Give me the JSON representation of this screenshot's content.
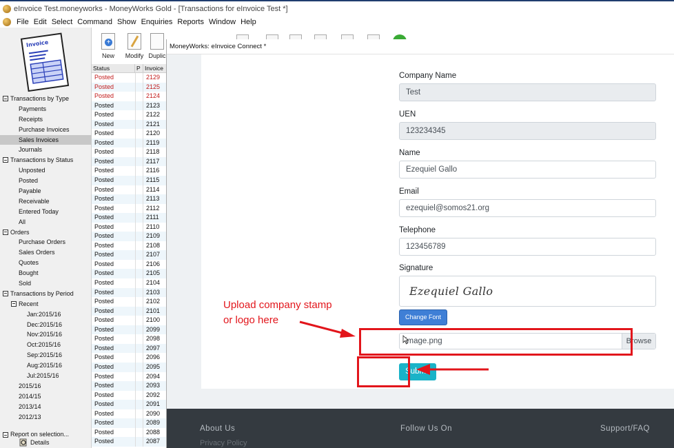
{
  "window": {
    "title": "eInvoice Test.moneyworks - MoneyWorks Gold - [Transactions for eInvoice Test *]"
  },
  "menubar": {
    "items": [
      "File",
      "Edit",
      "Select",
      "Command",
      "Show",
      "Enquiries",
      "Reports",
      "Window",
      "Help"
    ]
  },
  "sidebar": {
    "logo_text": "Invoice",
    "tree": [
      {
        "label": "Transactions by Type",
        "level": 0
      },
      {
        "label": "Payments",
        "level": 1
      },
      {
        "label": "Receipts",
        "level": 1
      },
      {
        "label": "Purchase Invoices",
        "level": 1
      },
      {
        "label": "Sales Invoices",
        "level": 1,
        "selected": true
      },
      {
        "label": "Journals",
        "level": 1
      },
      {
        "label": "Transactions by Status",
        "level": 0
      },
      {
        "label": "Unposted",
        "level": 1
      },
      {
        "label": "Posted",
        "level": 1
      },
      {
        "label": "Payable",
        "level": 1
      },
      {
        "label": "Receivable",
        "level": 1
      },
      {
        "label": "Entered Today",
        "level": 1
      },
      {
        "label": "All",
        "level": 1
      },
      {
        "label": "Orders",
        "level": 0
      },
      {
        "label": "Purchase Orders",
        "level": 1
      },
      {
        "label": "Sales Orders",
        "level": 1
      },
      {
        "label": "Quotes",
        "level": 1
      },
      {
        "label": "Bought",
        "level": 1
      },
      {
        "label": "Sold",
        "level": 1
      },
      {
        "label": "Transactions by Period",
        "level": 0
      },
      {
        "label": "Recent",
        "level": 1,
        "collapsible": true
      },
      {
        "label": "Jan:2015/16",
        "level": 2
      },
      {
        "label": "Dec:2015/16",
        "level": 2
      },
      {
        "label": "Nov:2015/16",
        "level": 2
      },
      {
        "label": "Oct:2015/16",
        "level": 2
      },
      {
        "label": "Sep:2015/16",
        "level": 2
      },
      {
        "label": "Aug:2015/16",
        "level": 2
      },
      {
        "label": "Jul:2015/16",
        "level": 2
      },
      {
        "label": "2015/16",
        "level": 1
      },
      {
        "label": "2014/15",
        "level": 1
      },
      {
        "label": "2013/14",
        "level": 1
      },
      {
        "label": "2012/13",
        "level": 1
      }
    ],
    "report_label": "Report on selection...",
    "details_label": "Details"
  },
  "toolbar": {
    "new_label": "New",
    "modify_label": "Modify",
    "duplicate_label": "Duplic"
  },
  "table": {
    "headers": {
      "status": "Status",
      "p": "P",
      "invoice": "Invoice"
    },
    "rows": [
      {
        "status": "Posted",
        "invoice": "2129",
        "red": true
      },
      {
        "status": "Posted",
        "invoice": "2125",
        "red": true
      },
      {
        "status": "Posted",
        "invoice": "2124",
        "red": true
      },
      {
        "status": "Posted",
        "invoice": "2123"
      },
      {
        "status": "Posted",
        "invoice": "2122"
      },
      {
        "status": "Posted",
        "invoice": "2121"
      },
      {
        "status": "Posted",
        "invoice": "2120"
      },
      {
        "status": "Posted",
        "invoice": "2119"
      },
      {
        "status": "Posted",
        "invoice": "2118"
      },
      {
        "status": "Posted",
        "invoice": "2117"
      },
      {
        "status": "Posted",
        "invoice": "2116"
      },
      {
        "status": "Posted",
        "invoice": "2115"
      },
      {
        "status": "Posted",
        "invoice": "2114"
      },
      {
        "status": "Posted",
        "invoice": "2113"
      },
      {
        "status": "Posted",
        "invoice": "2112"
      },
      {
        "status": "Posted",
        "invoice": "2111"
      },
      {
        "status": "Posted",
        "invoice": "2110"
      },
      {
        "status": "Posted",
        "invoice": "2109"
      },
      {
        "status": "Posted",
        "invoice": "2108"
      },
      {
        "status": "Posted",
        "invoice": "2107"
      },
      {
        "status": "Posted",
        "invoice": "2106"
      },
      {
        "status": "Posted",
        "invoice": "2105"
      },
      {
        "status": "Posted",
        "invoice": "2104"
      },
      {
        "status": "Posted",
        "invoice": "2103"
      },
      {
        "status": "Posted",
        "invoice": "2102"
      },
      {
        "status": "Posted",
        "invoice": "2101"
      },
      {
        "status": "Posted",
        "invoice": "2100"
      },
      {
        "status": "Posted",
        "invoice": "2099"
      },
      {
        "status": "Posted",
        "invoice": "2098"
      },
      {
        "status": "Posted",
        "invoice": "2097"
      },
      {
        "status": "Posted",
        "invoice": "2096"
      },
      {
        "status": "Posted",
        "invoice": "2095"
      },
      {
        "status": "Posted",
        "invoice": "2094"
      },
      {
        "status": "Posted",
        "invoice": "2093"
      },
      {
        "status": "Posted",
        "invoice": "2092"
      },
      {
        "status": "Posted",
        "invoice": "2091"
      },
      {
        "status": "Posted",
        "invoice": "2090"
      },
      {
        "status": "Posted",
        "invoice": "2089"
      },
      {
        "status": "Posted",
        "invoice": "2088"
      },
      {
        "status": "Posted",
        "invoice": "2087"
      }
    ]
  },
  "modal": {
    "title": "MoneyWorks: eInvoice Connect *",
    "form": {
      "company_name": {
        "label": "Company Name",
        "value": "Test"
      },
      "uen": {
        "label": "UEN",
        "value": "123234345"
      },
      "name": {
        "label": "Name",
        "value": "Ezequiel Gallo"
      },
      "email": {
        "label": "Email",
        "value": "ezequiel@somos21.org"
      },
      "telephone": {
        "label": "Telephone",
        "value": "123456789"
      },
      "signature": {
        "label": "Signature",
        "value": "Ezequiel Gallo"
      },
      "change_font_label": "Change Font",
      "file_value": "image.png",
      "browse_label": "Browse",
      "submit_label": "Submit"
    },
    "footer": {
      "about": "About Us",
      "follow": "Follow Us On",
      "support": "Support/FAQ",
      "partial": "Privacy Policy"
    }
  },
  "annotation": {
    "line1": "Upload company stamp",
    "line2": "or logo here",
    "color": "#e2151b"
  }
}
